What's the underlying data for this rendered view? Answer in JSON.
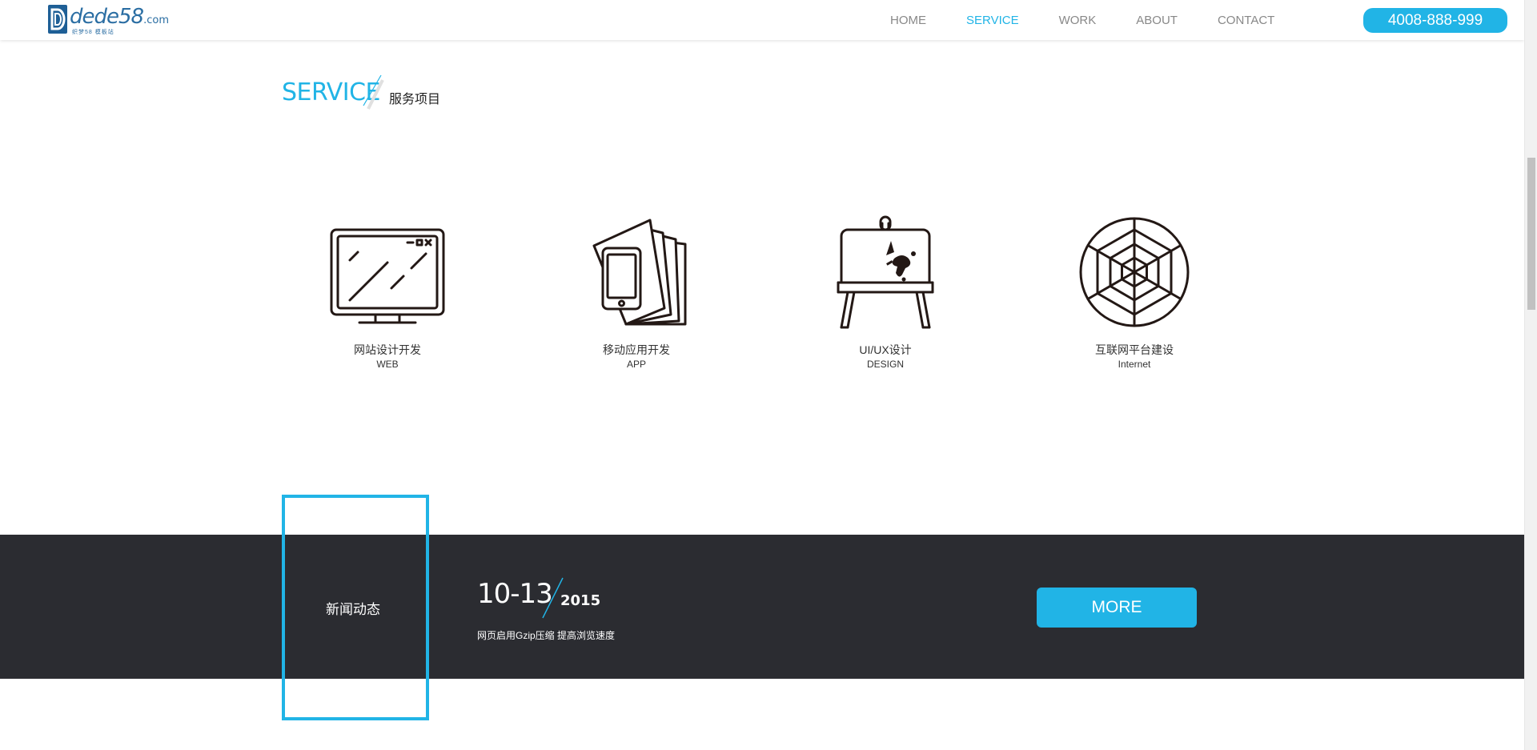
{
  "header": {
    "logo": {
      "text": "dede58",
      "suffix": ".com",
      "tagline": "织梦58 模板站"
    },
    "nav": [
      {
        "label": "HOME",
        "active": false
      },
      {
        "label": "SERVICE",
        "active": true
      },
      {
        "label": "WORK",
        "active": false
      },
      {
        "label": "ABOUT",
        "active": false
      },
      {
        "label": "CONTACT",
        "active": false
      }
    ],
    "phone": "4008-888-999"
  },
  "service": {
    "title_en": "SERVICE",
    "title_cn": "服务项目",
    "items": [
      {
        "name": "网站设计开发",
        "en": "WEB",
        "icon": "monitor-icon"
      },
      {
        "name": "移动应用开发",
        "en": "APP",
        "icon": "mobile-cards-icon"
      },
      {
        "name": "UI/UX设计",
        "en": "DESIGN",
        "icon": "easel-icon"
      },
      {
        "name": "互联网平台建设",
        "en": "Internet",
        "icon": "web-icon"
      }
    ]
  },
  "news": {
    "title": "新闻动态",
    "date": "10-13",
    "year": "2015",
    "headline": "网页启用Gzip压缩 提高浏览速度",
    "more_label": "MORE"
  },
  "colors": {
    "accent": "#21b4e6",
    "dark_band": "#2b2c31",
    "logo_blue": "#2b6ea3"
  }
}
